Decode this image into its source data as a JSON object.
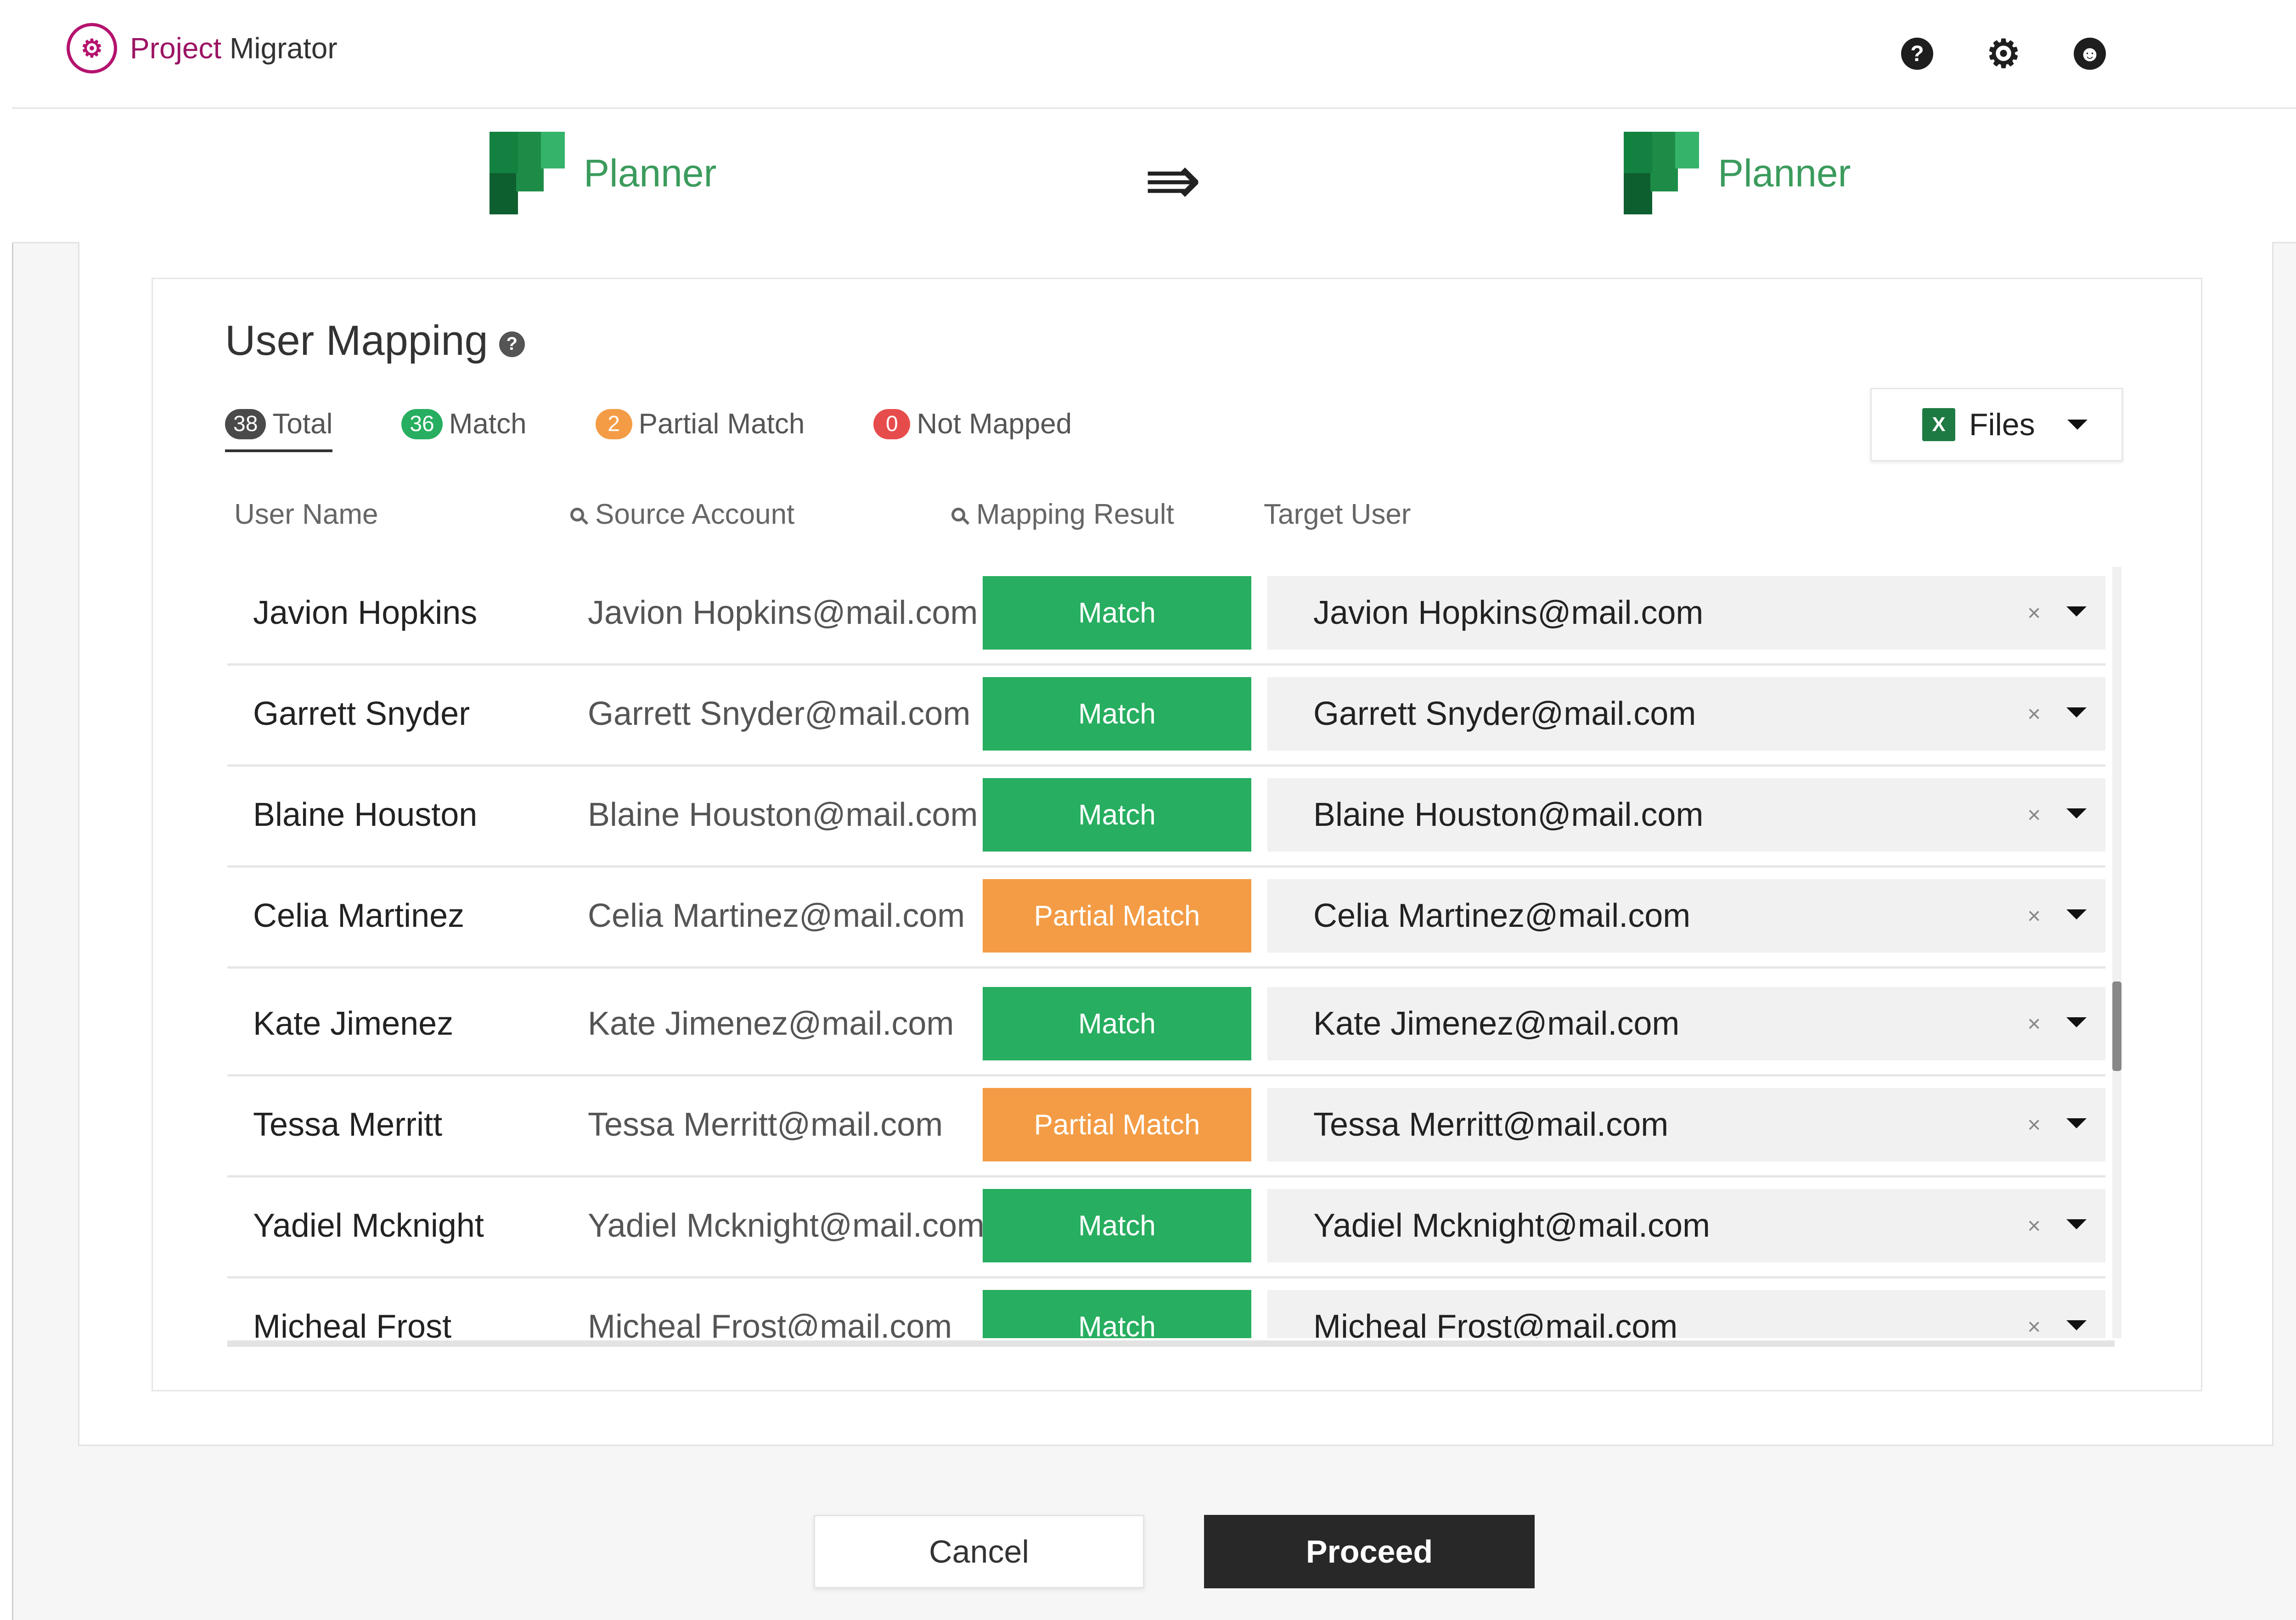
{
  "app": {
    "name_part1": "Project",
    "name_part2": " Migrator",
    "logo_glyph": "⚙"
  },
  "header_icons": [
    {
      "name": "help-icon",
      "glyph": "?"
    },
    {
      "name": "gear-icon",
      "glyph": "⚙"
    },
    {
      "name": "user-icon",
      "glyph": "☻"
    }
  ],
  "source_app": {
    "label": "Planner"
  },
  "target_app": {
    "label": "Planner"
  },
  "migration_arrow": "⇛",
  "mapping": {
    "title": "User Mapping",
    "help_glyph": "?",
    "stats": {
      "total": {
        "count": "38",
        "label": "Total",
        "color": "#4a4a4a"
      },
      "match": {
        "count": "36",
        "label": "Match",
        "color": "#27ae60"
      },
      "partial": {
        "count": "2",
        "label": "Partial Match",
        "color": "#f39c45"
      },
      "unmapped": {
        "count": "0",
        "label": "Not Mapped",
        "color": "#e74c4c"
      }
    },
    "files_button": {
      "label": "Files",
      "icon": "X"
    },
    "columns": {
      "user_name": "User Name",
      "source_account": "Source Account",
      "mapping_result": "Mapping Result",
      "target_user": "Target User"
    },
    "clear_glyph": "×",
    "result_colors": {
      "Match": "#27ae60",
      "Partial Match": "#f39c45"
    },
    "rows": [
      {
        "name": "Javion Hopkins",
        "source": "Javion Hopkins@mail.com",
        "result": "Match",
        "target": "Javion Hopkins@mail.com"
      },
      {
        "name": "Garrett Snyder",
        "source": "Garrett Snyder@mail.com",
        "result": "Match",
        "target": "Garrett Snyder@mail.com"
      },
      {
        "name": "Blaine Houston",
        "source": "Blaine Houston@mail.com",
        "result": "Match",
        "target": "Blaine Houston@mail.com"
      },
      {
        "name": "Celia Martinez",
        "source": "Celia Martinez@mail.com",
        "result": "Partial Match",
        "target": "Celia Martinez@mail.com"
      },
      {
        "name": "Kate Jimenez",
        "source": "Kate Jimenez@mail.com",
        "result": "Match",
        "target": "Kate Jimenez@mail.com"
      },
      {
        "name": "Tessa Merritt",
        "source": "Tessa Merritt@mail.com",
        "result": "Partial Match",
        "target": "Tessa Merritt@mail.com"
      },
      {
        "name": "Yadiel Mcknight",
        "source": "Yadiel Mcknight@mail.com",
        "result": "Match",
        "target": "Yadiel Mcknight@mail.com"
      },
      {
        "name": "Micheal Frost",
        "source": "Micheal Frost@mail.com",
        "result": "Match",
        "target": "Micheal Frost@mail.com"
      }
    ]
  },
  "actions": {
    "cancel": "Cancel",
    "proceed": "Proceed"
  }
}
